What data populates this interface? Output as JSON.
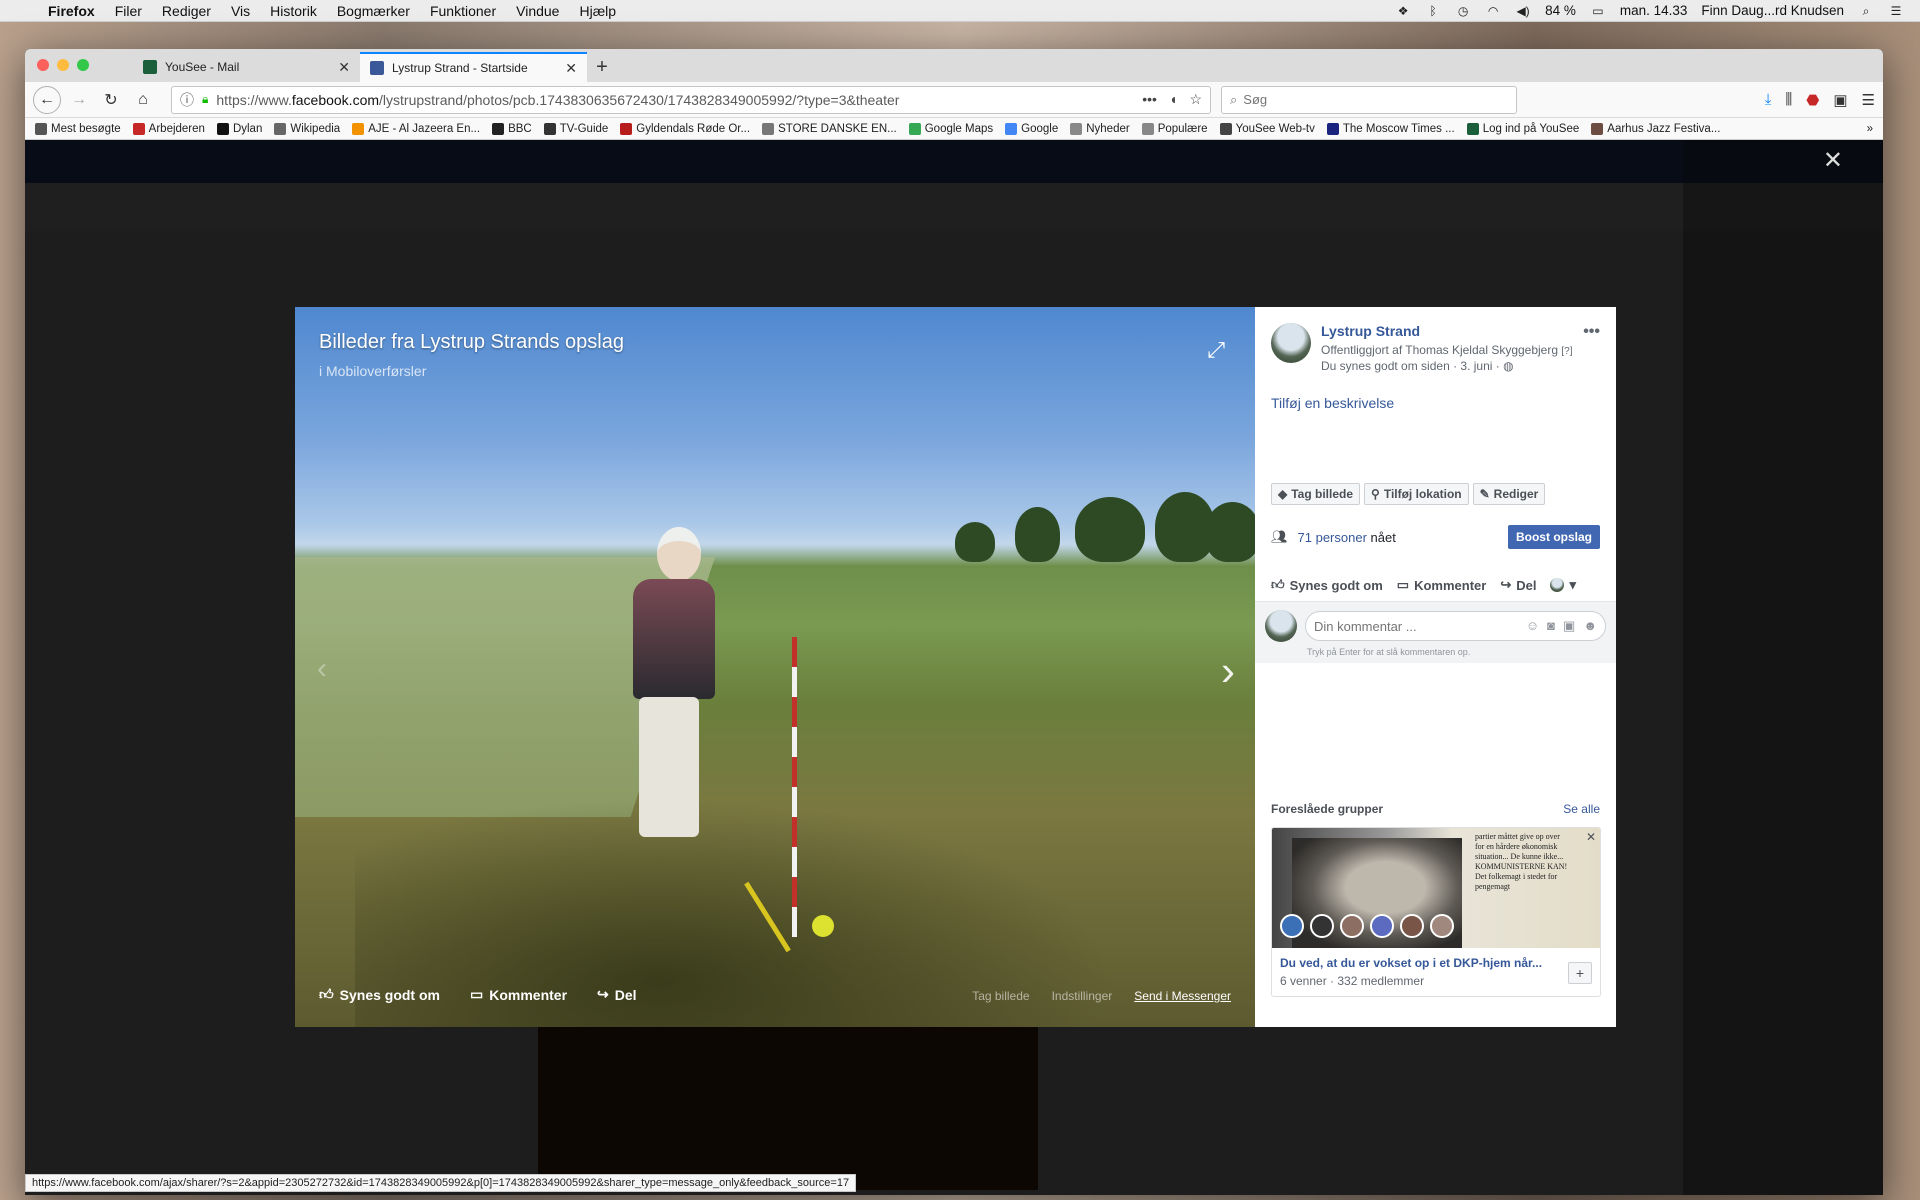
{
  "menubar": {
    "app": "Firefox",
    "menus": [
      "Filer",
      "Rediger",
      "Vis",
      "Historik",
      "Bogmærker",
      "Funktioner",
      "Vindue",
      "Hjælp"
    ],
    "battery": "84 %",
    "clock": "man. 14.33",
    "user": "Finn Daug...rd Knudsen"
  },
  "tabs": [
    {
      "title": "YouSee - Mail",
      "favicon_color": "#1a5e3a"
    },
    {
      "title": "Lystrup Strand - Startside",
      "favicon_color": "#3b5998"
    }
  ],
  "navbar": {
    "url_prefix": "https://www.",
    "url_domain": "facebook.com",
    "url_rest": "/lystrupstrand/photos/pcb.1743830635672430/1743828349005992/?type=3&theater",
    "search_placeholder": "Søg",
    "adblock_count": "12"
  },
  "bookmarks": [
    {
      "label": "Mest besøgte",
      "color": "#555"
    },
    {
      "label": "Arbejderen",
      "color": "#c62828"
    },
    {
      "label": "Dylan",
      "color": "#111"
    },
    {
      "label": "Wikipedia",
      "color": "#666"
    },
    {
      "label": "AJE - Al Jazeera En...",
      "color": "#f29200"
    },
    {
      "label": "BBC",
      "color": "#222"
    },
    {
      "label": "TV-Guide",
      "color": "#333"
    },
    {
      "label": "Gyldendals Røde Or...",
      "color": "#b71c1c"
    },
    {
      "label": "STORE DANSKE EN...",
      "color": "#777"
    },
    {
      "label": "Google Maps",
      "color": "#34a853"
    },
    {
      "label": "Google",
      "color": "#4285f4"
    },
    {
      "label": "Nyheder",
      "color": "#888"
    },
    {
      "label": "Populære",
      "color": "#888"
    },
    {
      "label": "YouSee Web-tv",
      "color": "#444"
    },
    {
      "label": "The Moscow Times ...",
      "color": "#1a237e"
    },
    {
      "label": "Log ind på YouSee",
      "color": "#1a5e3a"
    },
    {
      "label": "Aarhus Jazz Festiva...",
      "color": "#6d4c41"
    }
  ],
  "photo": {
    "title": "Billeder fra Lystrup Strands opslag",
    "album": "Mobiloverførsler",
    "actions": {
      "like": "Synes godt om",
      "comment": "Kommenter",
      "share": "Del"
    },
    "right_actions": {
      "tag": "Tag billede",
      "options": "Indstillinger",
      "messenger": "Send i Messenger"
    }
  },
  "post": {
    "page_name": "Lystrup Strand",
    "published_by": "Offentliggjort af Thomas Kjeldal Skyggebjerg",
    "published_help": "[?]",
    "liked_date": "Du synes godt om siden · 3. juni ·",
    "add_description": "Tilføj en beskrivelse",
    "tag_buttons": [
      "Tag billede",
      "Tilføj lokation",
      "Rediger"
    ],
    "reach_count": "71 personer",
    "reach_suffix": "nået",
    "boost_label": "Boost opslag",
    "reactions": {
      "like": "Synes godt om",
      "comment": "Kommenter",
      "share": "Del"
    },
    "comment_placeholder": "Din kommentar ...",
    "comment_hint": "Tryk på Enter for at slå kommentaren op."
  },
  "suggested": {
    "heading": "Foreslåede grupper",
    "see_all": "Se alle",
    "group_name": "Du ved, at du er vokset op i et DKP-hjem når...",
    "group_meta": "6 venner · 332 medlemmer",
    "newsprint": "partier måttet give op over for en hårdere økonomisk situation... De kunne ikke... KOMMUNISTERNE KAN! Det folkemagt i stedet for pengemagt"
  },
  "statusbar": {
    "text": "https://www.facebook.com/ajax/sharer/?s=2&appid=2305272732&id=1743828349005992&p[0]=1743828349005992&sharer_type=message_only&feedback_source=17"
  }
}
